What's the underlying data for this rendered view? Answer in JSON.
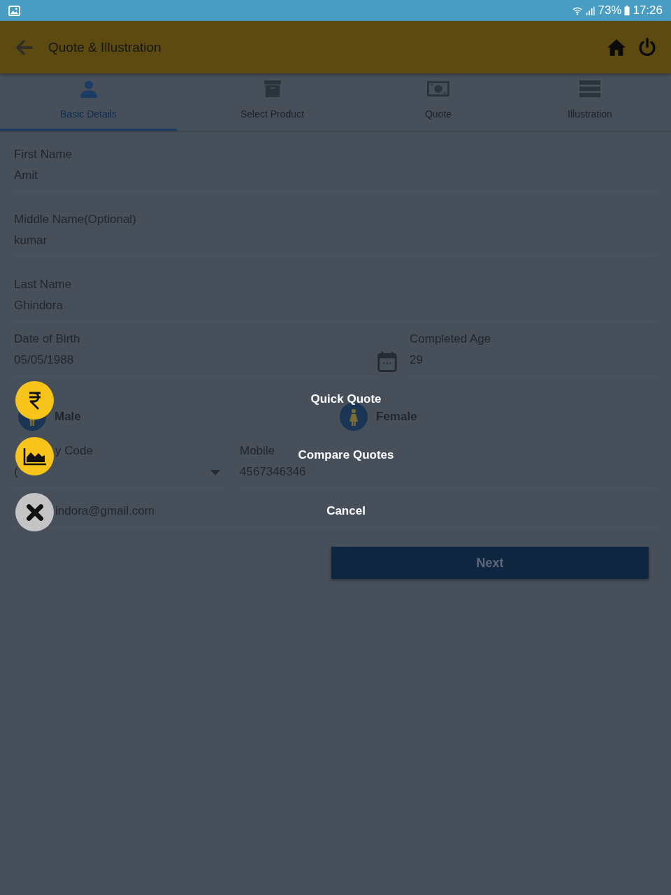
{
  "status_bar": {
    "battery": "73%",
    "time": "17:26"
  },
  "header": {
    "title": "Quote & Illustration"
  },
  "tabs": [
    {
      "label": "Basic Details",
      "kind": "person",
      "selected": true
    },
    {
      "label": "Select Product",
      "kind": "archive",
      "selected": false
    },
    {
      "label": "Quote",
      "kind": "money",
      "selected": false
    },
    {
      "label": "Illustration",
      "kind": "list",
      "selected": false
    }
  ],
  "fields": [
    {
      "label": "First Name",
      "value": "Amit"
    },
    {
      "label": "Middle Name(Optional)",
      "value": "kumar"
    },
    {
      "label": "Last Name",
      "value": "Ghindora"
    }
  ],
  "dob": {
    "label": "Date of Birth",
    "value": "05/05/1988"
  },
  "age": {
    "label": "Completed Age",
    "value": "29"
  },
  "gender": {
    "options": [
      {
        "label": "Male",
        "kind": "male",
        "selected": false
      },
      {
        "label": "Female",
        "kind": "female",
        "selected": false
      }
    ]
  },
  "country_code": {
    "label": "y Code",
    "value": "("
  },
  "mobile": {
    "label": "Mobile",
    "value": "4567346346"
  },
  "email": {
    "value": "indora@gmail.com"
  },
  "next_button": "Next",
  "fab_menu": [
    {
      "kind": "rupee",
      "label": "Quick Quote"
    },
    {
      "kind": "chart",
      "label": "Compare Quotes"
    },
    {
      "kind": "close",
      "label": "Cancel"
    }
  ]
}
